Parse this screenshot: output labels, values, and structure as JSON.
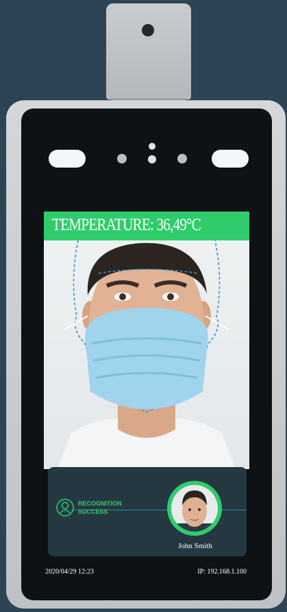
{
  "temperature": {
    "label": "TEMPERATURE: 36,49°C"
  },
  "recognition": {
    "status_line1": "RECOGNITION",
    "status_line2": "SUCCESS",
    "name": "John Smith"
  },
  "status_bar": {
    "datetime": "2020/04/29  12:23",
    "ip": "IP: 192.168.1.100"
  },
  "colors": {
    "accent": "#2fcc6b",
    "background": "#2c4454",
    "card": "#253842"
  },
  "icons": {
    "user": "user-icon"
  }
}
